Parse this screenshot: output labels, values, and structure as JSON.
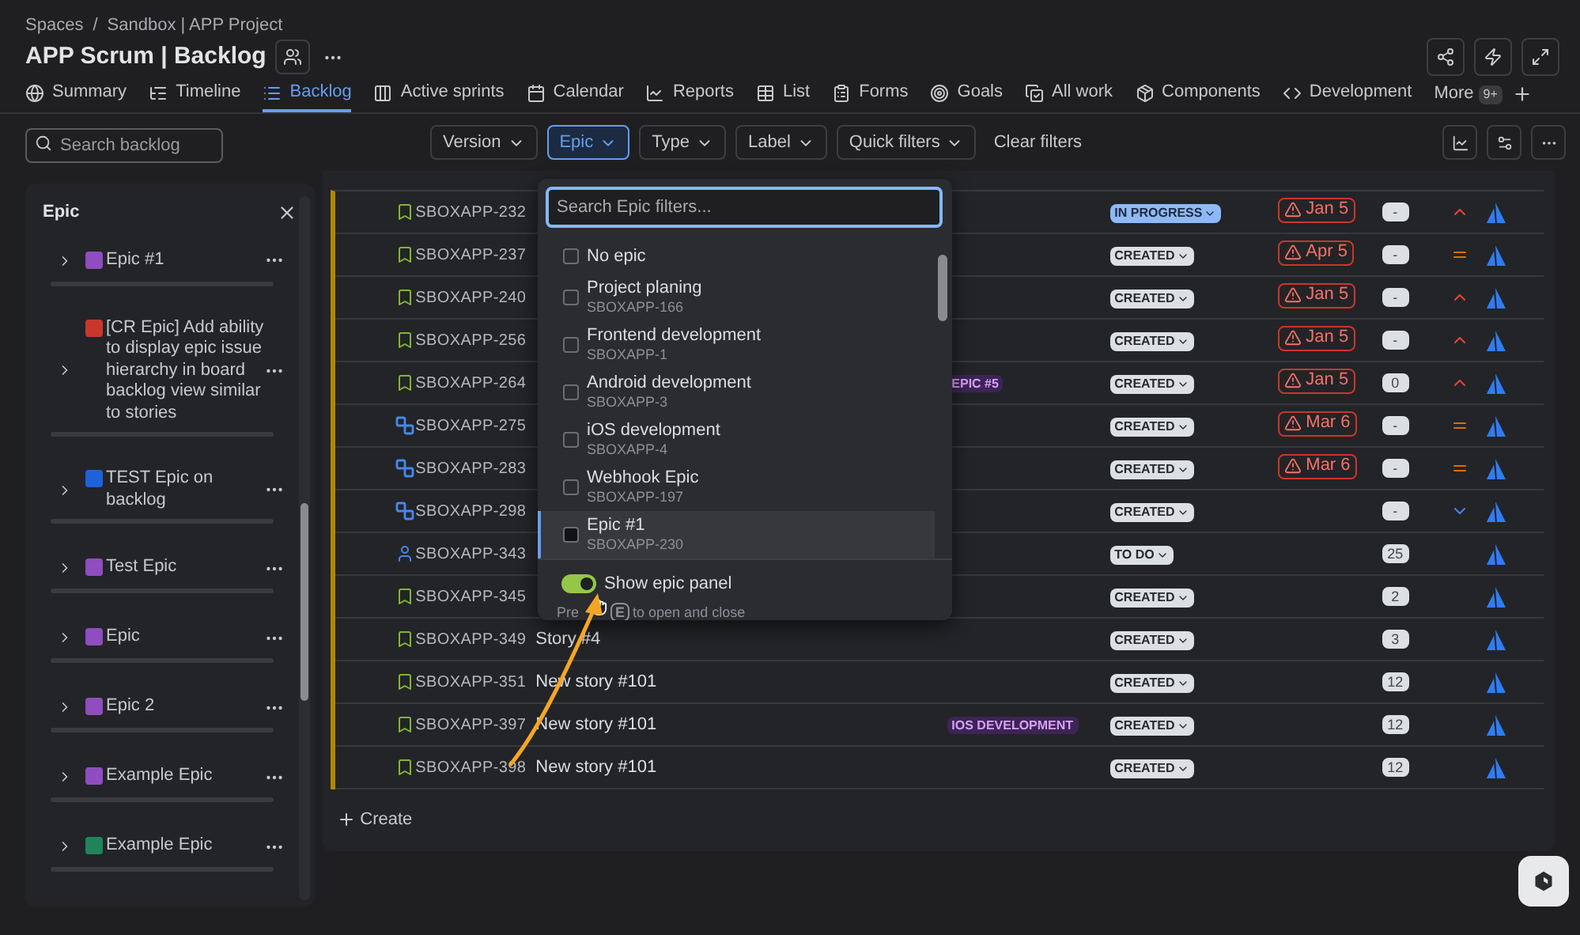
{
  "breadcrumb": {
    "items": [
      "Spaces",
      "Sandbox | APP Project"
    ],
    "separator": "/"
  },
  "title": "APP Scrum | Backlog",
  "tabs": [
    {
      "label": "Summary",
      "selected": false
    },
    {
      "label": "Timeline",
      "selected": false
    },
    {
      "label": "Backlog",
      "selected": true
    },
    {
      "label": "Active sprints",
      "selected": false
    },
    {
      "label": "Calendar",
      "selected": false
    },
    {
      "label": "Reports",
      "selected": false
    },
    {
      "label": "List",
      "selected": false
    },
    {
      "label": "Forms",
      "selected": false
    },
    {
      "label": "Goals",
      "selected": false
    },
    {
      "label": "All work",
      "selected": false
    },
    {
      "label": "Components",
      "selected": false
    },
    {
      "label": "Development",
      "selected": false
    }
  ],
  "more_tab": {
    "label": "More",
    "badge": "9+"
  },
  "search": {
    "placeholder": "Search backlog"
  },
  "filters": [
    {
      "label": "Version",
      "selected": false
    },
    {
      "label": "Epic",
      "selected": true
    },
    {
      "label": "Type",
      "selected": false
    },
    {
      "label": "Label",
      "selected": false
    },
    {
      "label": "Quick filters",
      "selected": false
    }
  ],
  "clear_filters": "Clear filters",
  "epic_panel": {
    "title": "Epic",
    "items": [
      {
        "name": "Epic #1",
        "color": "#8f4dc0",
        "level": 0
      },
      {
        "name": "[CR Epic] Add ability to display epic issue hierarchy in board backlog view similar to stories",
        "color": "#c9372c",
        "level": 0
      },
      {
        "name": "TEST Epic on backlog",
        "color": "#1d62d8",
        "level": 0
      },
      {
        "name": "Test Epic",
        "color": "#8f4dc0",
        "level": 0
      },
      {
        "name": "Epic",
        "color": "#8f4dc0",
        "level": 0
      },
      {
        "name": "Epic 2",
        "color": "#8f4dc0",
        "level": 0
      },
      {
        "name": "Example Epic",
        "color": "#8f4dc0",
        "level": 0
      },
      {
        "name": "Example Epic",
        "color": "#1f845a",
        "level": 0
      }
    ]
  },
  "rows": [
    {
      "key": "SBOXAPP-232",
      "kind": "story",
      "status": {
        "text": "IN PROGRESS",
        "kind": "in_progress"
      },
      "due": "Jan 5",
      "estimate": "-",
      "priority": {
        "kind": "high"
      }
    },
    {
      "key": "SBOXAPP-237",
      "kind": "story",
      "status": {
        "text": "CREATED",
        "kind": "created"
      },
      "due": "Apr 5",
      "estimate": "-",
      "priority": {
        "kind": "medium"
      }
    },
    {
      "key": "SBOXAPP-240",
      "kind": "story",
      "status": {
        "text": "CREATED",
        "kind": "created"
      },
      "due": "Jan 5",
      "estimate": "-",
      "priority": {
        "kind": "high"
      }
    },
    {
      "key": "SBOXAPP-256",
      "kind": "story",
      "status": {
        "text": "CREATED",
        "kind": "created"
      },
      "due": "Jan 5",
      "estimate": "-",
      "priority": {
        "kind": "high"
      }
    },
    {
      "key": "SBOXAPP-264",
      "kind": "story",
      "epic": "EPIC #5",
      "status": {
        "text": "CREATED",
        "kind": "created"
      },
      "due": "Jan 5",
      "estimate": "0",
      "priority": {
        "kind": "high"
      }
    },
    {
      "key": "SBOXAPP-275",
      "kind": "subtask",
      "status": {
        "text": "CREATED",
        "kind": "created"
      },
      "due": "Mar 6",
      "estimate": "-",
      "priority": {
        "kind": "medium"
      }
    },
    {
      "key": "SBOXAPP-283",
      "kind": "subtask",
      "status": {
        "text": "CREATED",
        "kind": "created"
      },
      "due": "Mar 6",
      "estimate": "-",
      "priority": {
        "kind": "medium"
      }
    },
    {
      "key": "SBOXAPP-298",
      "kind": "subtask",
      "status": {
        "text": "CREATED",
        "kind": "created"
      },
      "estimate": "-",
      "priority": {
        "kind": "low"
      }
    },
    {
      "key": "SBOXAPP-343",
      "kind": "user",
      "status": {
        "text": "TO DO",
        "kind": "todo"
      },
      "estimate": "25"
    },
    {
      "key": "SBOXAPP-345",
      "kind": "story",
      "status": {
        "text": "CREATED",
        "kind": "created"
      },
      "estimate": "2"
    },
    {
      "key": "SBOXAPP-349",
      "kind": "story",
      "summary": "Story #4",
      "status": {
        "text": "CREATED",
        "kind": "created"
      },
      "estimate": "3"
    },
    {
      "key": "SBOXAPP-351",
      "kind": "story",
      "summary": "New story #101",
      "status": {
        "text": "CREATED",
        "kind": "created"
      },
      "estimate": "12"
    },
    {
      "key": "SBOXAPP-397",
      "kind": "story",
      "summary": "New story #101",
      "epic": "IOS DEVELOPMENT",
      "status": {
        "text": "CREATED",
        "kind": "created"
      },
      "estimate": "12"
    },
    {
      "key": "SBOXAPP-398",
      "kind": "story",
      "summary": "New story #101",
      "status": {
        "text": "CREATED",
        "kind": "created"
      },
      "estimate": "12"
    }
  ],
  "create": "Create",
  "epic_dropdown": {
    "placeholder": "Search Epic filters...",
    "items": [
      {
        "name": "No epic",
        "checked": false,
        "highlighted": false
      },
      {
        "name": "Project planing",
        "key": "SBOXAPP-166",
        "checked": false,
        "highlighted": false
      },
      {
        "name": "Frontend development",
        "key": "SBOXAPP-1",
        "checked": false,
        "highlighted": false
      },
      {
        "name": "Android development",
        "key": "SBOXAPP-3",
        "checked": false,
        "highlighted": false
      },
      {
        "name": "iOS development",
        "key": "SBOXAPP-4",
        "checked": false,
        "highlighted": false
      },
      {
        "name": "Webhook Epic",
        "key": "SBOXAPP-197",
        "checked": false,
        "highlighted": false
      },
      {
        "name": "Epic #1",
        "key": "SBOXAPP-230",
        "checked": false,
        "highlighted": true
      }
    ],
    "toggle": {
      "label": "Show epic panel",
      "on": true
    },
    "hint": {
      "text_start": "Pre",
      "key": "E",
      "text_end": "to open and close"
    }
  }
}
